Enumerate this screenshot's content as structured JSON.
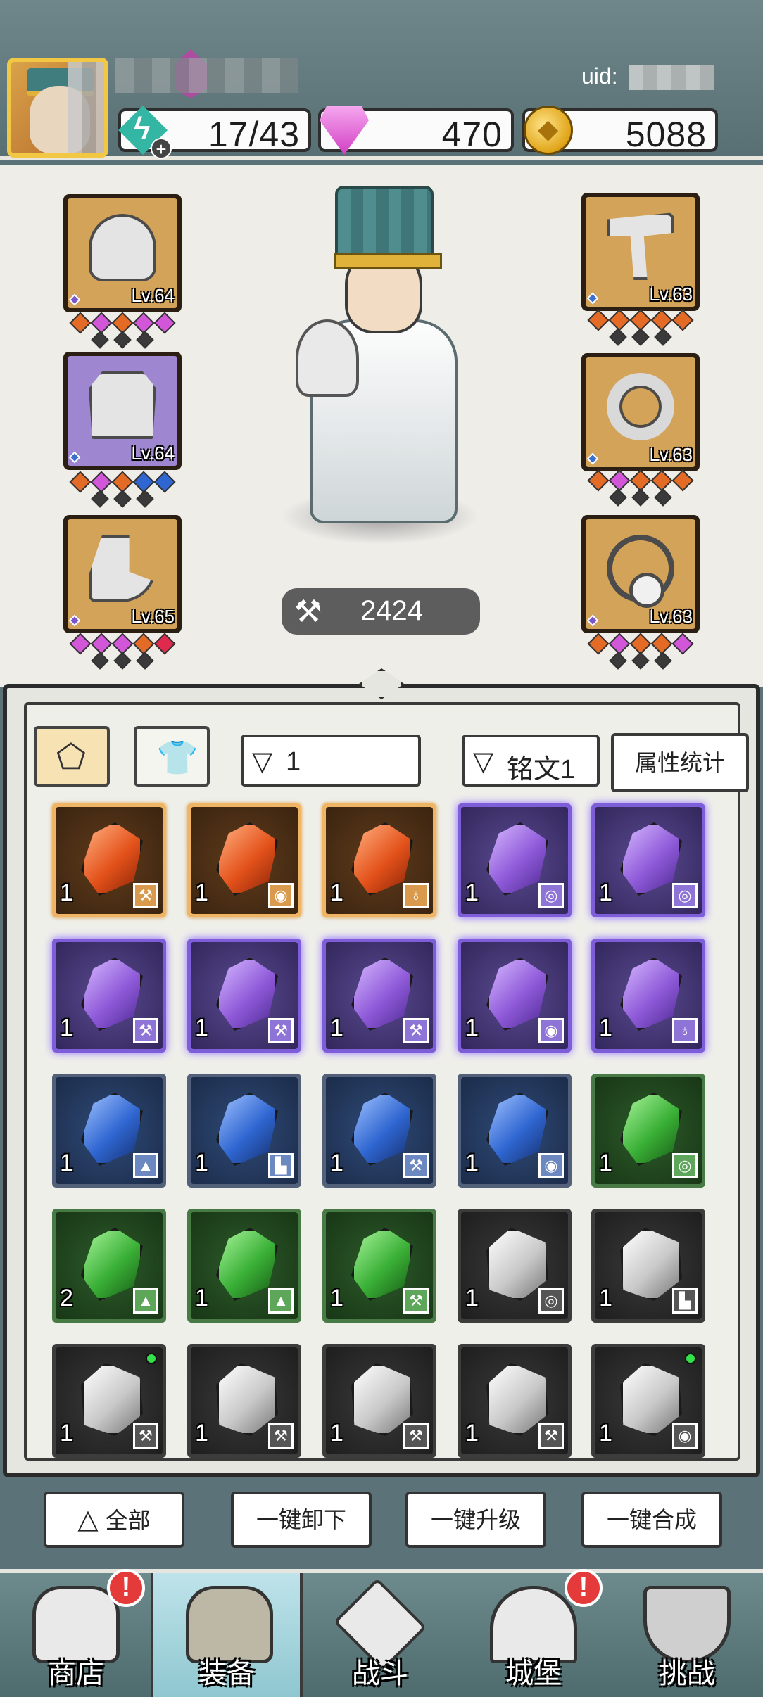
{
  "header": {
    "uid_label": "uid:",
    "energy": "17/43",
    "energy_plus": "+",
    "gems": "470",
    "gold": "5088"
  },
  "equipment": {
    "left": [
      {
        "slot": "helmet",
        "level": "Lv.64",
        "rarity": "purple",
        "sockets_top": [
          "orange",
          "pink",
          "orange",
          "pink",
          "pink"
        ]
      },
      {
        "slot": "armor",
        "level": "Lv.64",
        "rarity": "blue",
        "sockets_top": [
          "orange",
          "pink",
          "orange",
          "blue",
          "blue"
        ]
      },
      {
        "slot": "boots",
        "level": "Lv.65",
        "rarity": "purple",
        "sockets_top": [
          "pink",
          "pink",
          "pink",
          "orange",
          "red"
        ]
      }
    ],
    "right": [
      {
        "slot": "weapon",
        "level": "Lv.63",
        "rarity": "blue",
        "sockets_top": [
          "orange",
          "orange",
          "orange",
          "orange",
          "orange"
        ]
      },
      {
        "slot": "ring",
        "level": "Lv.63",
        "rarity": "blue",
        "sockets_top": [
          "orange",
          "pink",
          "orange",
          "orange",
          "orange"
        ]
      },
      {
        "slot": "necklace",
        "level": "Lv.63",
        "rarity": "purple",
        "sockets_top": [
          "orange",
          "pink",
          "orange",
          "orange",
          "pink"
        ]
      }
    ]
  },
  "hero": {
    "power_icon": "power-icon",
    "power": "2424"
  },
  "inventory": {
    "filter_level": "1",
    "filter_rune": "铭文1",
    "stats_button": "属性统计",
    "items": [
      {
        "rarity": "orange",
        "qty": "1",
        "type": "⚒",
        "dot": false
      },
      {
        "rarity": "orange",
        "qty": "1",
        "type": "◉",
        "dot": false
      },
      {
        "rarity": "orange",
        "qty": "1",
        "type": "♁",
        "dot": false
      },
      {
        "rarity": "purple",
        "qty": "1",
        "type": "◎",
        "dot": false
      },
      {
        "rarity": "purple",
        "qty": "1",
        "type": "◎",
        "dot": false
      },
      {
        "rarity": "purple",
        "qty": "1",
        "type": "⚒",
        "dot": false
      },
      {
        "rarity": "purple",
        "qty": "1",
        "type": "⚒",
        "dot": false
      },
      {
        "rarity": "purple",
        "qty": "1",
        "type": "⚒",
        "dot": false
      },
      {
        "rarity": "purple",
        "qty": "1",
        "type": "◉",
        "dot": false
      },
      {
        "rarity": "purple",
        "qty": "1",
        "type": "♁",
        "dot": false
      },
      {
        "rarity": "blue",
        "qty": "1",
        "type": "▲",
        "dot": false
      },
      {
        "rarity": "blue",
        "qty": "1",
        "type": "▙",
        "dot": false
      },
      {
        "rarity": "blue",
        "qty": "1",
        "type": "⚒",
        "dot": false
      },
      {
        "rarity": "blue",
        "qty": "1",
        "type": "◉",
        "dot": false
      },
      {
        "rarity": "green",
        "qty": "1",
        "type": "◎",
        "dot": false
      },
      {
        "rarity": "green",
        "qty": "2",
        "type": "▲",
        "dot": false
      },
      {
        "rarity": "green",
        "qty": "1",
        "type": "▲",
        "dot": false
      },
      {
        "rarity": "green",
        "qty": "1",
        "type": "⚒",
        "dot": false
      },
      {
        "rarity": "gray",
        "qty": "1",
        "type": "◎",
        "dot": false
      },
      {
        "rarity": "gray",
        "qty": "1",
        "type": "▙",
        "dot": false
      },
      {
        "rarity": "gray",
        "qty": "1",
        "type": "⚒",
        "dot": true
      },
      {
        "rarity": "gray",
        "qty": "1",
        "type": "⚒",
        "dot": false
      },
      {
        "rarity": "gray",
        "qty": "1",
        "type": "⚒",
        "dot": false
      },
      {
        "rarity": "gray",
        "qty": "1",
        "type": "⚒",
        "dot": false
      },
      {
        "rarity": "gray",
        "qty": "1",
        "type": "◉",
        "dot": true
      }
    ]
  },
  "actions": {
    "all": "全部",
    "unequip_all": "一键卸下",
    "upgrade_all": "一键升级",
    "merge_all": "一键合成"
  },
  "nav": {
    "items": [
      {
        "label": "商店",
        "icon": "shop-icon",
        "alert": "!"
      },
      {
        "label": "装备",
        "icon": "equipment-bag-icon",
        "alert": ""
      },
      {
        "label": "战斗",
        "icon": "crossed-swords-icon",
        "alert": ""
      },
      {
        "label": "城堡",
        "icon": "castle-icon",
        "alert": "!"
      },
      {
        "label": "挑战",
        "icon": "shield-icon",
        "alert": ""
      }
    ]
  },
  "colors": {
    "orange": "#e36b26",
    "purple": "#8f5ad9",
    "blue": "#2f66d1",
    "green": "#3ab037",
    "gray": "#c9c9c9",
    "accent_gold": "#f2c744"
  }
}
